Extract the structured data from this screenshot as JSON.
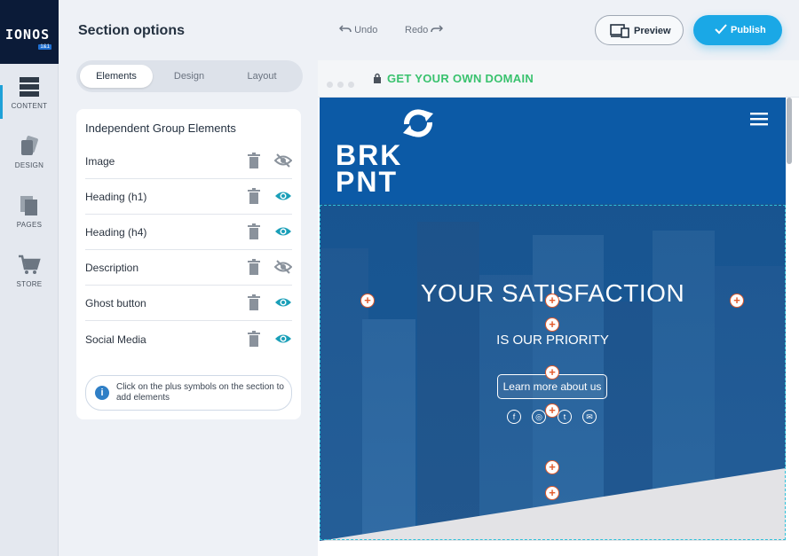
{
  "brand": {
    "logo_text": "IONOS",
    "logo_badge": "1&1"
  },
  "rail": {
    "items": [
      {
        "label": "CONTENT",
        "icon": "content-icon"
      },
      {
        "label": "DESIGN",
        "icon": "design-icon"
      },
      {
        "label": "PAGES",
        "icon": "pages-icon"
      },
      {
        "label": "STORE",
        "icon": "cart-icon"
      }
    ]
  },
  "panel": {
    "title": "Section options",
    "tabs": [
      "Elements",
      "Design",
      "Layout"
    ],
    "active_tab": "Elements",
    "group_title": "Independent Group Elements",
    "elements": [
      {
        "label": "Image",
        "visible": false
      },
      {
        "label": "Heading (h1)",
        "visible": true
      },
      {
        "label": "Heading (h4)",
        "visible": true
      },
      {
        "label": "Description",
        "visible": false
      },
      {
        "label": "Ghost button",
        "visible": true
      },
      {
        "label": "Social Media",
        "visible": true
      }
    ],
    "hint": "Click on the plus symbols on the section to add elements"
  },
  "toolbar": {
    "undo": "Undo",
    "redo": "Redo",
    "preview": "Preview",
    "publish": "Publish"
  },
  "preview": {
    "domain": "GET YOUR OWN DOMAIN",
    "site_logo": [
      "BRK",
      "PNT"
    ],
    "heading": "YOUR SATISFACTION",
    "subheading": "IS OUR PRIORITY",
    "button": "Learn more about us",
    "social": [
      "facebook",
      "instagram",
      "twitter",
      "email"
    ]
  },
  "colors": {
    "accent": "#1aa8e6",
    "header_blue": "#0c5aa6",
    "domain_green": "#39c26e",
    "plus_orange": "#e25a2b",
    "selection_dash": "#2fc0d8"
  }
}
